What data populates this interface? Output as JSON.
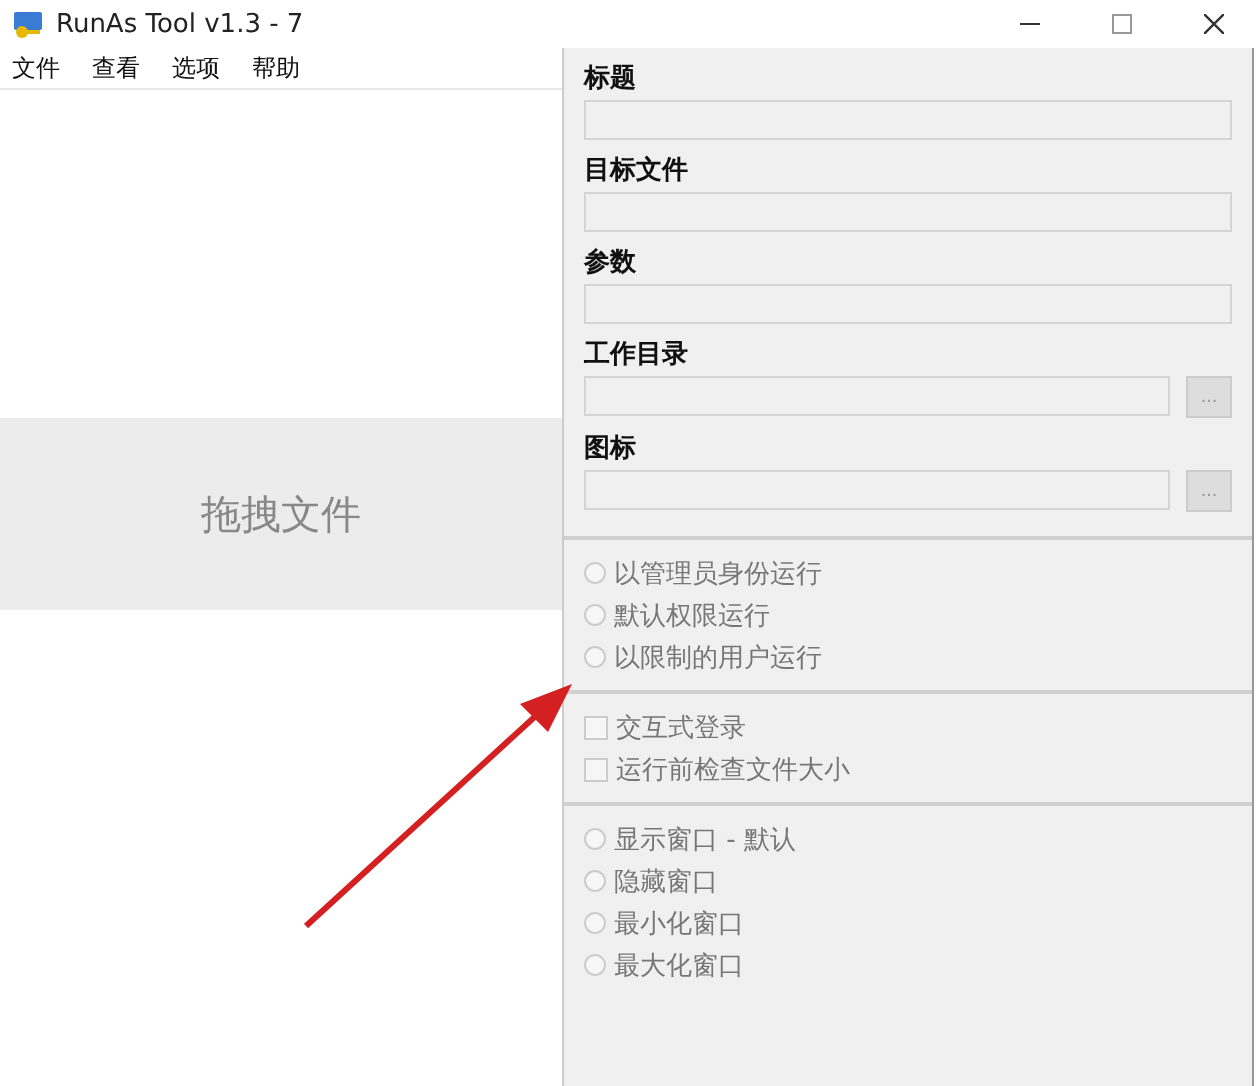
{
  "window": {
    "title": "RunAs Tool v1.3 - 7"
  },
  "menu": [
    "文件",
    "查看",
    "选项",
    "帮助"
  ],
  "drop_zone": {
    "label": "拖拽文件"
  },
  "fields": [
    {
      "label": "标题"
    },
    {
      "label": "目标文件"
    },
    {
      "label": "参数"
    },
    {
      "label": "工作目录",
      "button": "..."
    },
    {
      "label": "图标",
      "button": "..."
    }
  ],
  "groups": [
    {
      "kind": "radio",
      "options": [
        {
          "label": "以管理员身份运行",
          "selected": false,
          "disabled": true
        },
        {
          "label": "默认权限运行",
          "selected": false,
          "disabled": true
        },
        {
          "label": "以限制的用户运行",
          "selected": false,
          "disabled": true
        }
      ]
    },
    {
      "kind": "checkbox",
      "options": [
        {
          "label": "交互式登录",
          "checked": false,
          "disabled": true
        },
        {
          "label": "运行前检查文件大小",
          "checked": false,
          "disabled": true
        }
      ]
    },
    {
      "kind": "radio",
      "options": [
        {
          "label": "显示窗口 - 默认",
          "selected": false,
          "disabled": true
        },
        {
          "label": "隐藏窗口",
          "selected": false,
          "disabled": true
        },
        {
          "label": "最小化窗口",
          "selected": false,
          "disabled": true
        },
        {
          "label": "最大化窗口",
          "selected": false,
          "disabled": true
        }
      ]
    }
  ]
}
